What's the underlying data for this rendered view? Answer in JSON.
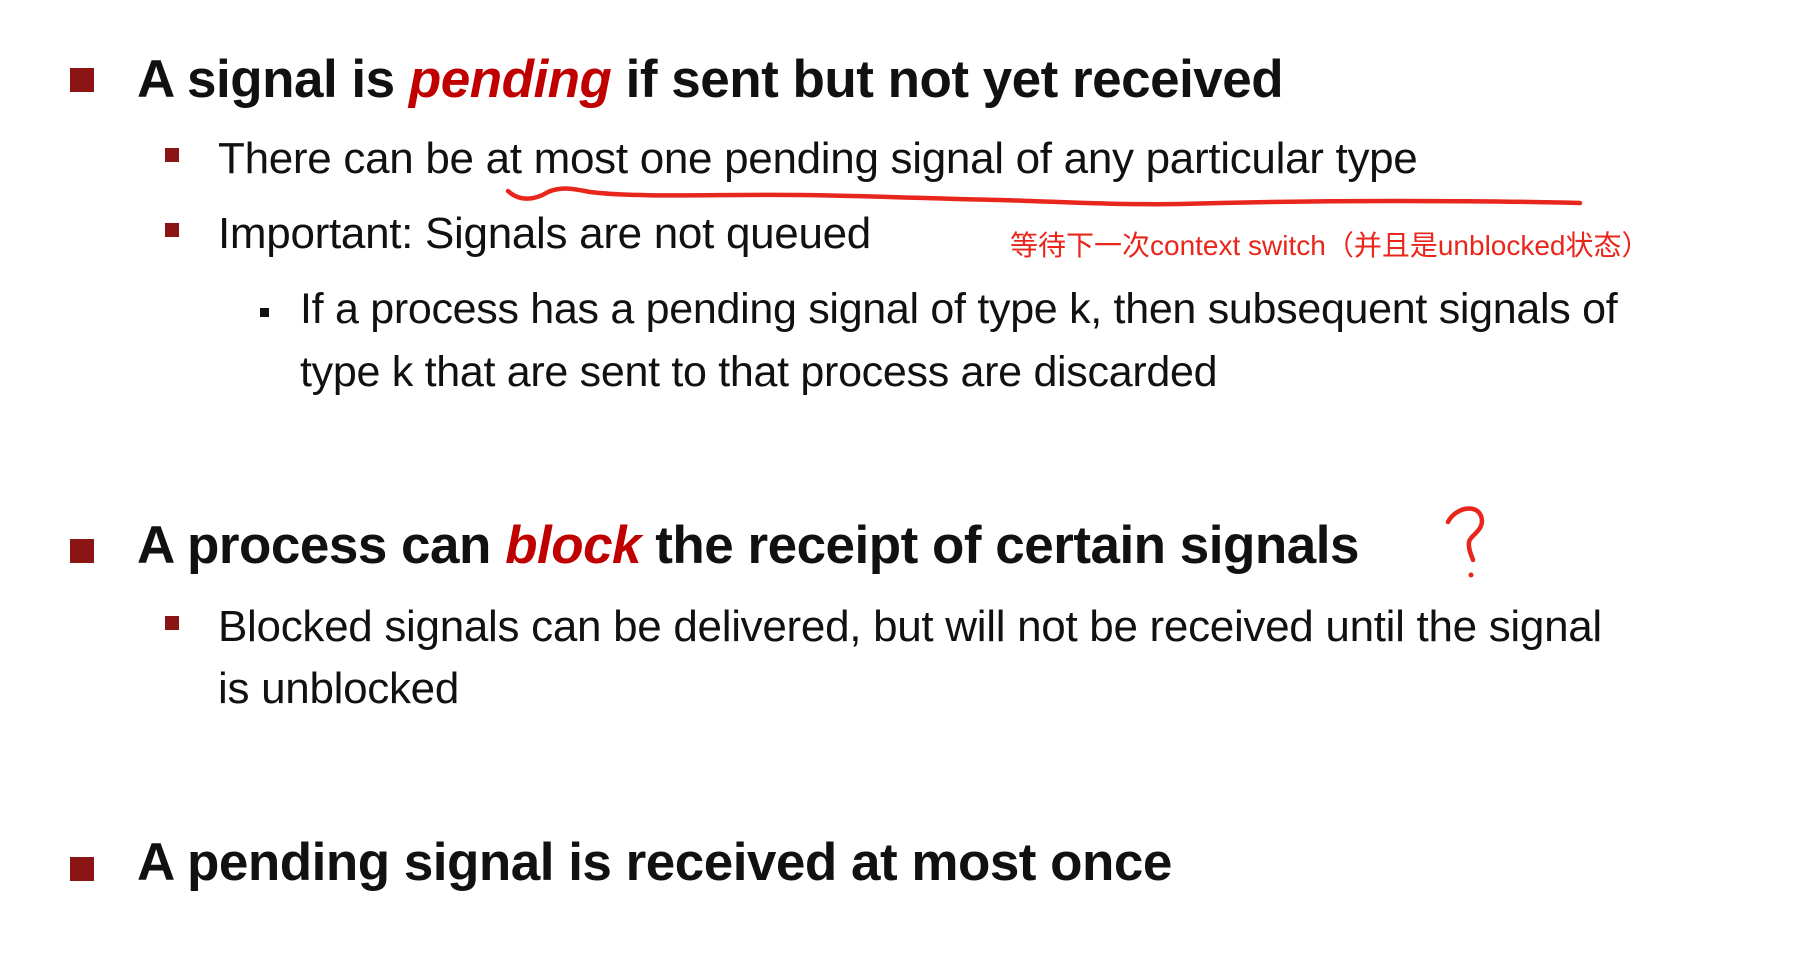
{
  "colors": {
    "bullet": "#8b1414",
    "emphasis": "#c00000",
    "annotation": "#e8261c",
    "text": "#111111"
  },
  "items": {
    "p1": {
      "pre": "A signal is ",
      "em": "pending",
      "post": " if sent but not yet received"
    },
    "p1_s1": "There can be at most one pending signal of any particular type",
    "p1_s2": "Important: Signals are not queued",
    "p1_s2_ss1_line1": "If a process has a pending signal of type k, then subsequent signals of",
    "p1_s2_ss1_line2": "type k that are sent to that process are discarded",
    "p2": {
      "pre": "A process can ",
      "em": "block",
      "post": " the receipt of certain signals"
    },
    "p2_s1_line1": "Blocked signals can be delivered, but will not be received until the signal",
    "p2_s1_line2": "is unblocked",
    "p3": "A pending signal is received at most once"
  },
  "annotations": {
    "note": "等待下一次context switch（并且是unblocked状态）",
    "question_mark": "?"
  }
}
